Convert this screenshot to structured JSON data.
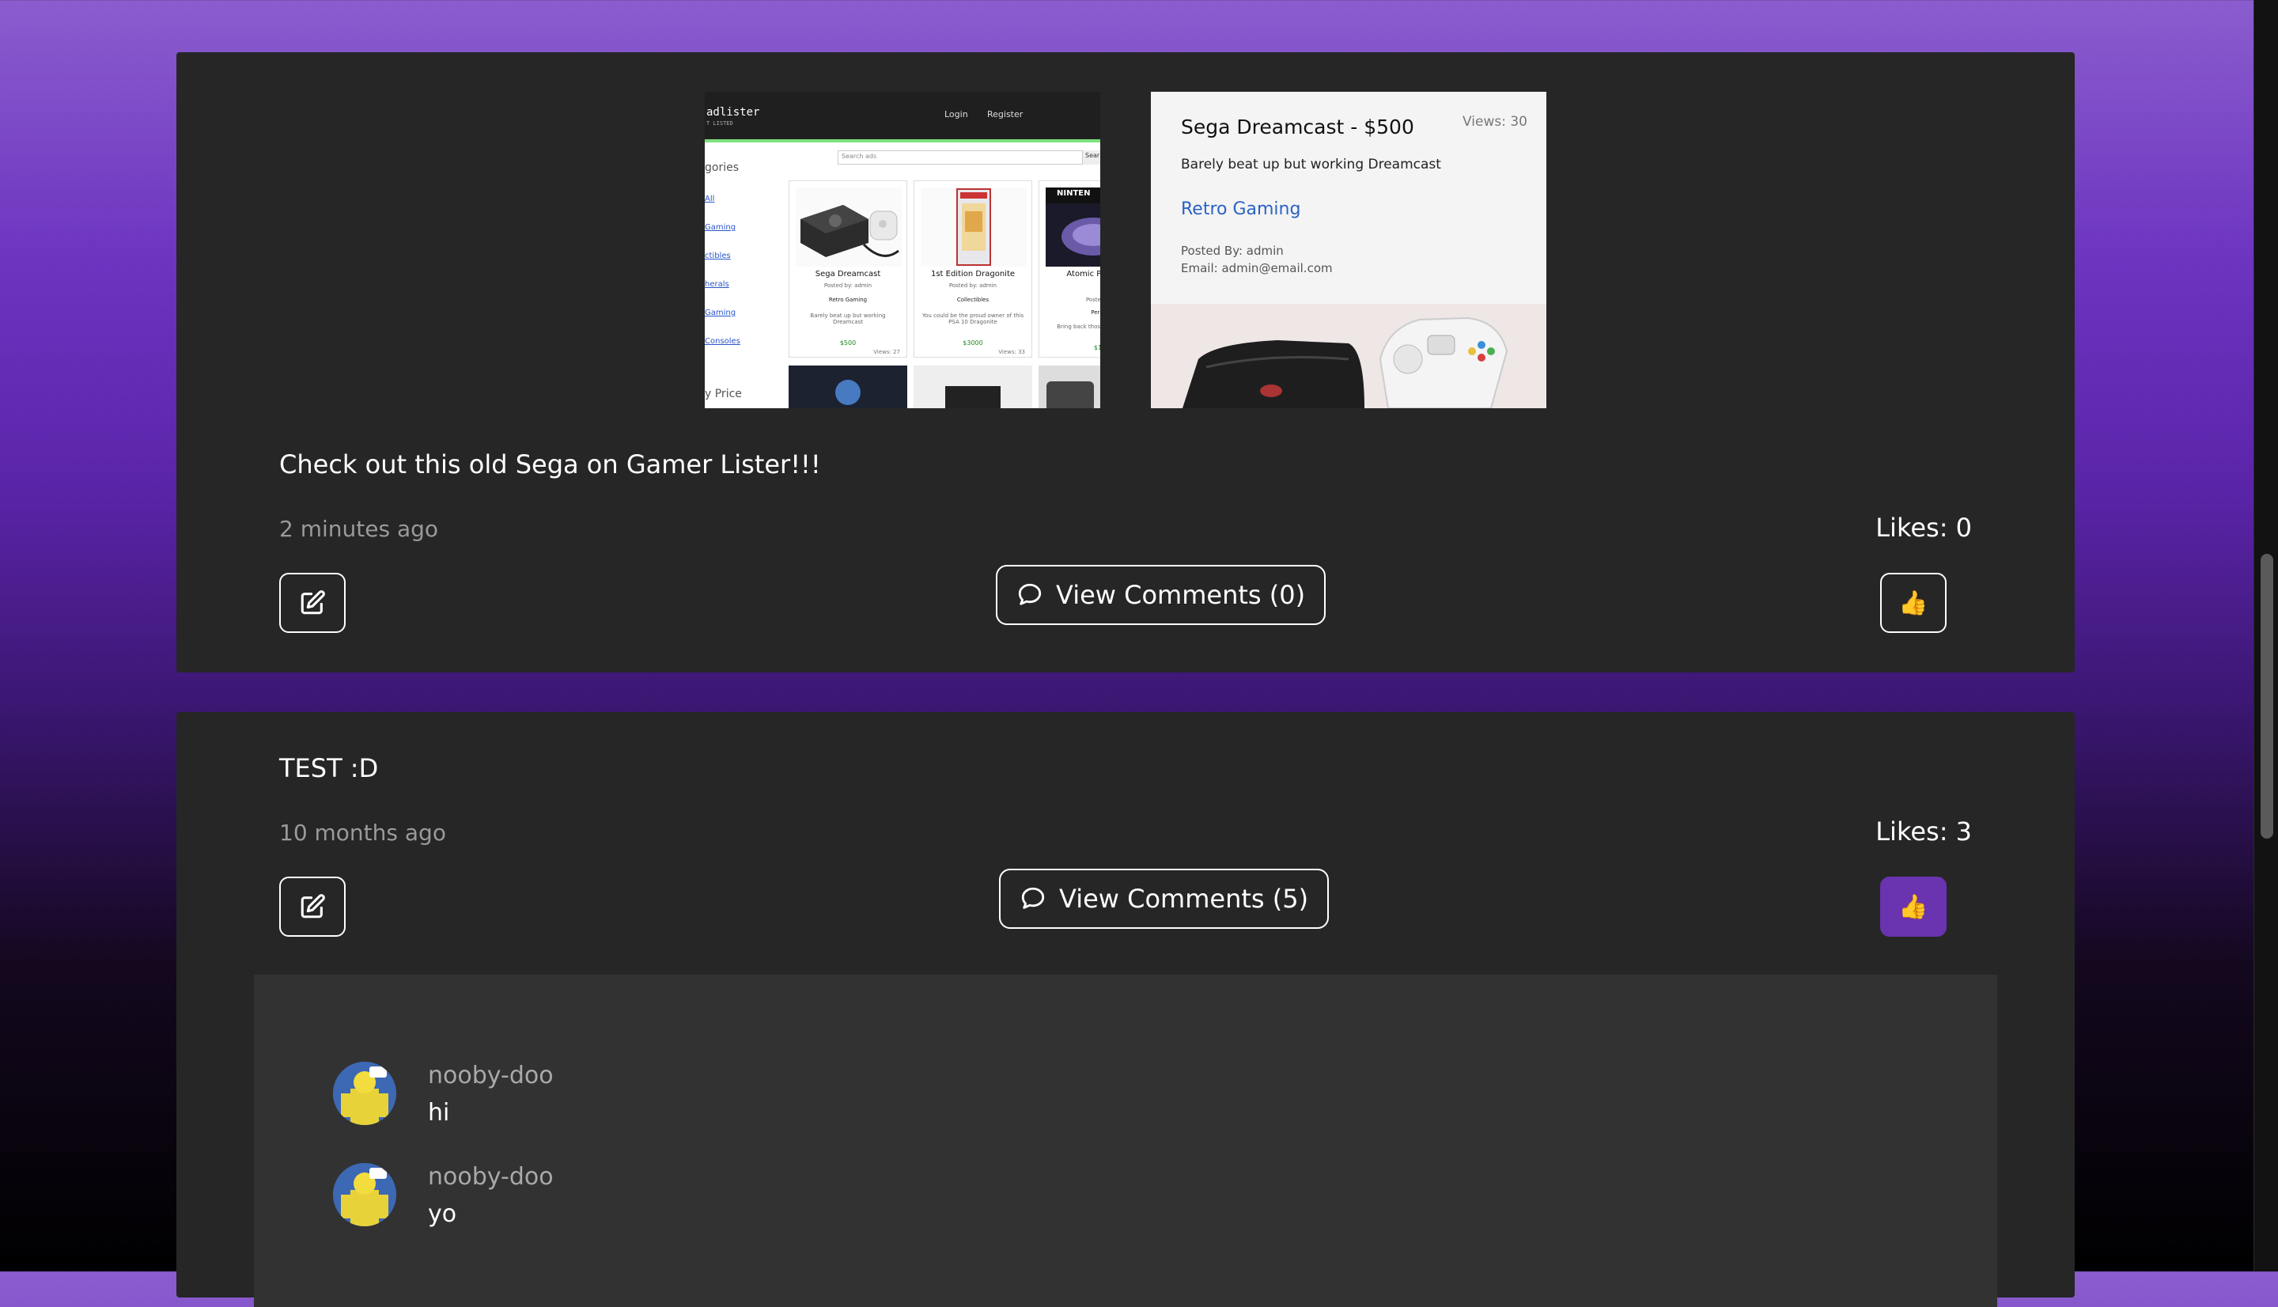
{
  "posts": [
    {
      "text": "Check out this old Sega on Gamer Lister!!!",
      "time": "2 minutes ago",
      "likes_label": "Likes: 0",
      "comments_label": "View Comments (0)",
      "liked": false,
      "preview_site": {
        "brand": "adlister",
        "tagline": "T LISTED",
        "nav_login": "Login",
        "nav_register": "Register",
        "search_placeholder": "Search ads",
        "search_button": "Sear",
        "heading": "gories",
        "categories": [
          "All",
          "Gaming",
          "ctibles",
          "herals",
          "Gaming",
          "Consoles"
        ],
        "products": [
          {
            "title": "Sega Dreamcast",
            "posted": "Posted by: admin",
            "category": "Retro Gaming",
            "desc": "Barely beat up but working Dreamcast",
            "price": "$500",
            "views": "Views: 27"
          },
          {
            "title": "1st Edition Dragonite",
            "posted": "Posted by: admin",
            "category": "Collectibles",
            "desc": "You could be the proud owner of this PSA 10 Dragonite",
            "price": "$3000",
            "views": "Views: 33"
          },
          {
            "title": "Atomic Pu contr",
            "posted": "Posted b",
            "category": "Perip",
            "desc": "Bring back those with this cla",
            "price": "$1",
            "views": ""
          }
        ],
        "price_label": "y Price",
        "third_logo": "NINTEN"
      },
      "preview_ad": {
        "title": "Sega Dreamcast - $500",
        "views": "Views: 30",
        "description": "Barely beat up but working Dreamcast",
        "category": "Retro Gaming",
        "posted_by": "Posted By: admin",
        "email": "Email: admin@email.com"
      }
    },
    {
      "text": "TEST :D",
      "time": "10 months ago",
      "likes_label": "Likes: 3",
      "comments_label": "View Comments (5)",
      "liked": true,
      "comments": [
        {
          "user": "nooby-doo",
          "text": "hi"
        },
        {
          "user": "nooby-doo",
          "text": "yo"
        }
      ]
    }
  ],
  "icons": {
    "edit": "edit-icon",
    "comment": "comment-bubble-icon",
    "like": "thumbs-up-icon"
  },
  "like_emoji": "👍",
  "colors": {
    "accent_purple": "#6a33b0",
    "card_bg": "#262626",
    "comments_bg": "#323232",
    "link_blue": "#2a63c4"
  }
}
